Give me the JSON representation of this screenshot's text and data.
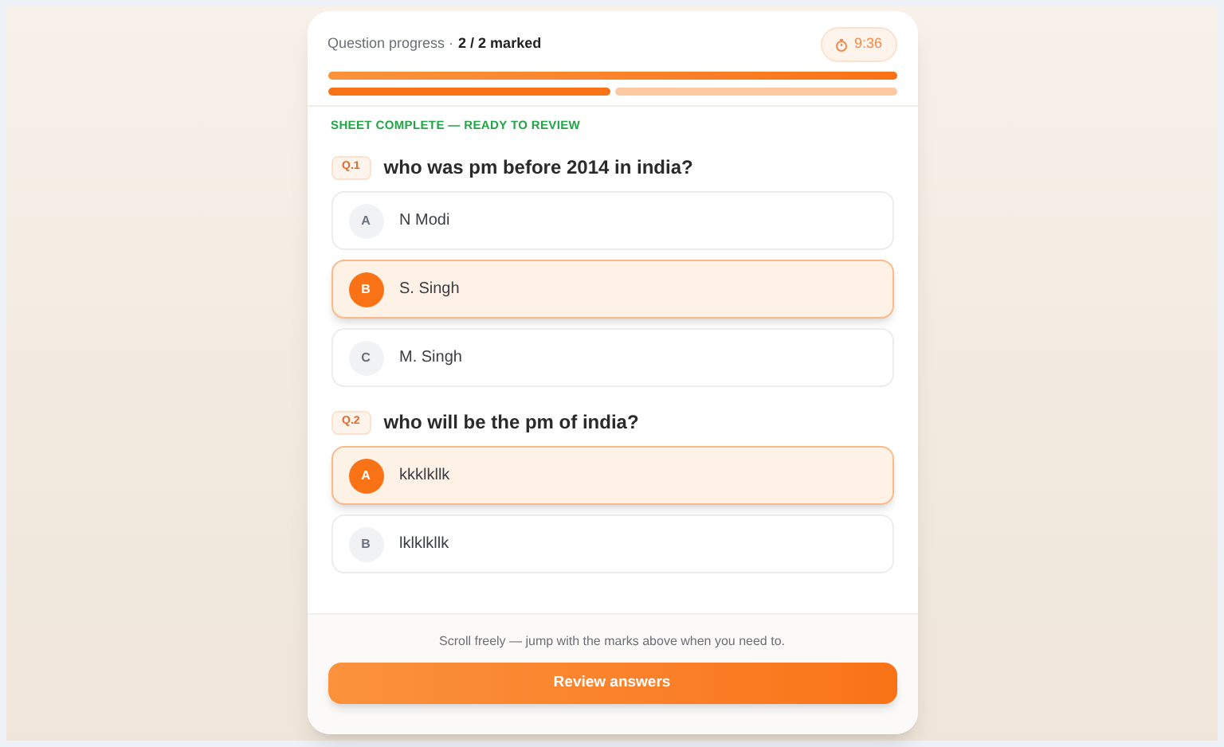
{
  "header": {
    "label": "Question progress ·",
    "count": "2 / 2 marked",
    "timer": "9:36"
  },
  "progress": {
    "level": 1
  },
  "marks": [
    {
      "selected": true
    },
    {
      "selected": false
    }
  ],
  "status": "SHEET COMPLETE — READY TO REVIEW",
  "questions": [
    {
      "number": "Q.1",
      "text": "who was pm before 2014 in india?",
      "options": [
        {
          "letter": "A",
          "text": "N Modi",
          "selected": false
        },
        {
          "letter": "B",
          "text": "S. Singh",
          "selected": true
        },
        {
          "letter": "C",
          "text": "M. Singh",
          "selected": false
        }
      ]
    },
    {
      "number": "Q.2",
      "text": "who will be the pm of india?",
      "options": [
        {
          "letter": "A",
          "text": "kkklkllk",
          "selected": true
        },
        {
          "letter": "B",
          "text": "lklklkllk",
          "selected": false
        }
      ]
    }
  ],
  "footer": {
    "hint": "Scroll freely — jump with the marks above when you need to.",
    "button": "Review answers"
  }
}
